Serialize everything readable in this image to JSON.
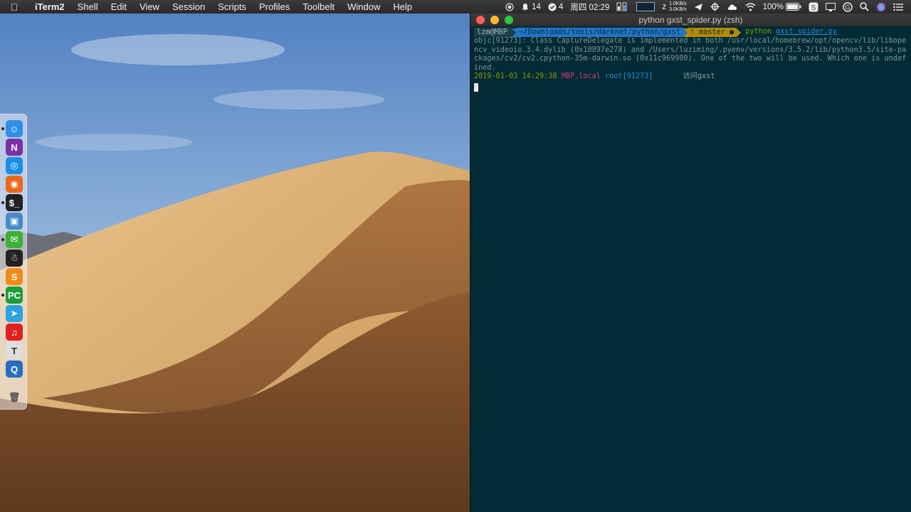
{
  "menubar": {
    "app_name": "iTerm2",
    "menus": [
      "Shell",
      "Edit",
      "View",
      "Session",
      "Scripts",
      "Profiles",
      "Toolbelt",
      "Window",
      "Help"
    ],
    "notifications_count": "14",
    "badge_count": "4",
    "datetime": "周四 02:29",
    "net_up": "1.0KB/s",
    "net_down": "3.0KB/s",
    "battery": "100%"
  },
  "dock": {
    "items": [
      {
        "name": "finder",
        "glyph": "☺",
        "color": "#2e8ee8"
      },
      {
        "name": "onenote",
        "glyph": "N",
        "color": "#7a2fa8"
      },
      {
        "name": "safari",
        "glyph": "◎",
        "color": "#1a8ee6"
      },
      {
        "name": "firefox",
        "glyph": "◉",
        "color": "#e86a1a"
      },
      {
        "name": "terminal",
        "glyph": "$_",
        "color": "#222222"
      },
      {
        "name": "preview",
        "glyph": "▣",
        "color": "#4a8ac8"
      },
      {
        "name": "wechat",
        "glyph": "✉",
        "color": "#3cb034"
      },
      {
        "name": "qq",
        "glyph": "☃",
        "color": "#222222"
      },
      {
        "name": "sublime-text",
        "glyph": "S",
        "color": "#f08a1a"
      },
      {
        "name": "pycharm",
        "glyph": "PC",
        "color": "#1a9e3a"
      },
      {
        "name": "telegram",
        "glyph": "➤",
        "color": "#2aa3de"
      },
      {
        "name": "netease-music",
        "glyph": "♫",
        "color": "#e02020"
      },
      {
        "name": "typora",
        "glyph": "T",
        "color": "#dddddd"
      },
      {
        "name": "quicktime",
        "glyph": "Q",
        "color": "#2a6cc0"
      },
      {
        "name": "trash",
        "glyph": "🗑",
        "color": "#999999"
      }
    ]
  },
  "terminal": {
    "window_title": "python gxst_spider.py (zsh)",
    "prompt": {
      "user_host": "lzm@MBP",
      "path": "~/Downloads/tools/darknet/python/gxst",
      "git_branch": "ᚠ master ●",
      "command": "python",
      "argument": "gxst_spider.py"
    },
    "output": "objc[91273]: Class CaptureDelegate is implemented in both /usr/local/homebrew/opt/opencv/lib/libopencv_videoio.3.4.dylib (0x10897e278) and /Users/luziming/.pyenv/versions/3.5.2/lib/python3.5/site-packages/cv2/cv2.cpython-35m-darwin.so (0x11c969980). One of the two will be used. Which one is undefined.",
    "log": {
      "datetime": "2019-01-03 14:29:38",
      "host": "MBP.local",
      "process": "root[91273]",
      "message": "访问gxst"
    }
  },
  "colors": {
    "terminal_bg": "#022b35",
    "path_segment": "#2176c7",
    "git_segment": "#b58900"
  }
}
